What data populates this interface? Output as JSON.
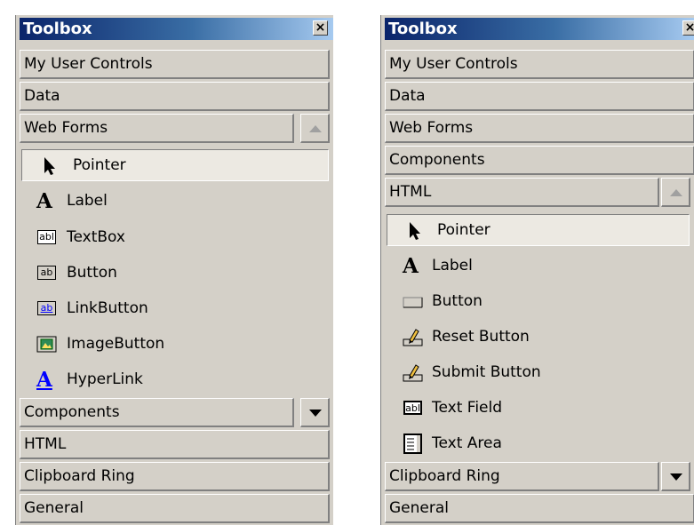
{
  "left": {
    "title": "Toolbox",
    "tabs": {
      "my_user_controls": "My User Controls",
      "data": "Data",
      "web_forms": "Web Forms",
      "components": "Components",
      "html": "HTML",
      "clipboard_ring": "Clipboard Ring",
      "general": "General"
    },
    "items": [
      {
        "label": "Pointer",
        "icon": "pointer-icon",
        "selected": true
      },
      {
        "label": "Label",
        "icon": "label-icon"
      },
      {
        "label": "TextBox",
        "icon": "textbox-icon"
      },
      {
        "label": "Button",
        "icon": "button-icon"
      },
      {
        "label": "LinkButton",
        "icon": "linkbutton-icon"
      },
      {
        "label": "ImageButton",
        "icon": "imagebutton-icon"
      },
      {
        "label": "HyperLink",
        "icon": "hyperlink-icon"
      }
    ]
  },
  "right": {
    "title": "Toolbox",
    "tabs": {
      "my_user_controls": "My User Controls",
      "data": "Data",
      "web_forms": "Web Forms",
      "components": "Components",
      "html": "HTML",
      "clipboard_ring": "Clipboard Ring",
      "general": "General"
    },
    "items": [
      {
        "label": "Pointer",
        "icon": "pointer-icon",
        "selected": true
      },
      {
        "label": "Label",
        "icon": "label-icon"
      },
      {
        "label": "Button",
        "icon": "html-button-icon"
      },
      {
        "label": "Reset Button",
        "icon": "reset-button-icon"
      },
      {
        "label": "Submit Button",
        "icon": "submit-button-icon"
      },
      {
        "label": "Text Field",
        "icon": "text-field-icon"
      },
      {
        "label": "Text Area",
        "icon": "text-area-icon"
      }
    ]
  },
  "icons": {
    "close_glyph": "×",
    "textbox_glyph": "abl",
    "button_glyph": "ab",
    "label_glyph": "A"
  },
  "colors": {
    "panel_bg": "#d4d0c8",
    "titlebar_start": "#0a246a",
    "titlebar_end": "#a6caf0",
    "link_blue": "#0000ff"
  }
}
